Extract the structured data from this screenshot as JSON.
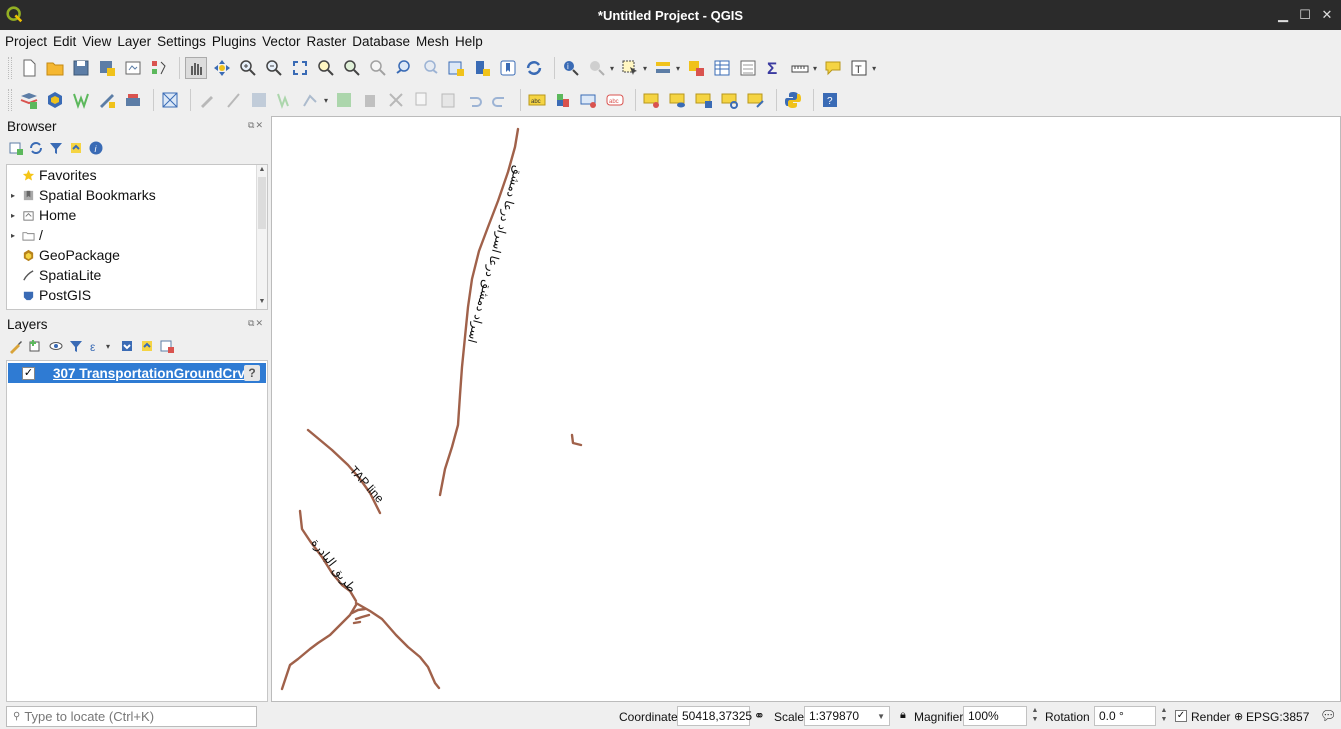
{
  "window": {
    "title": "*Untitled Project - QGIS",
    "controls": [
      "minimize",
      "maximize",
      "close"
    ]
  },
  "menubar": {
    "items": [
      "Project",
      "Edit",
      "View",
      "Layer",
      "Settings",
      "Plugins",
      "Vector",
      "Raster",
      "Database",
      "Mesh",
      "Help"
    ]
  },
  "browser": {
    "title": "Browser",
    "items": [
      {
        "label": "Favorites",
        "icon": "star-icon",
        "expandable": false
      },
      {
        "label": "Spatial Bookmarks",
        "icon": "bookmark-icon",
        "expandable": true
      },
      {
        "label": "Home",
        "icon": "home-folder-icon",
        "expandable": true
      },
      {
        "label": "/",
        "icon": "folder-icon",
        "expandable": true
      },
      {
        "label": "GeoPackage",
        "icon": "geopackage-icon",
        "expandable": false
      },
      {
        "label": "SpatiaLite",
        "icon": "spatialite-icon",
        "expandable": false
      },
      {
        "label": "PostGIS",
        "icon": "postgis-icon",
        "expandable": false
      }
    ]
  },
  "layers": {
    "title": "Layers",
    "items": [
      {
        "label": "307 TransportationGroundCrv",
        "checked": true,
        "selected": true
      }
    ]
  },
  "map": {
    "line_color": "#a0614a",
    "labels": [
      "اسراد دمشق درعا اسراد درعا دمشق",
      "TAP line",
      "طريق البادرة"
    ]
  },
  "statusbar": {
    "locator_placeholder": "Type to locate (Ctrl+K)",
    "coordinate_label": "Coordinate",
    "coordinate_value": "50418,37325",
    "scale_label": "Scale",
    "scale_value": "1:379870",
    "magnifier_label": "Magnifier",
    "magnifier_value": "100%",
    "rotation_label": "Rotation",
    "rotation_value": "0.0 °",
    "render_label": "Render",
    "render_checked": true,
    "crs_label": "EPSG:3857"
  }
}
